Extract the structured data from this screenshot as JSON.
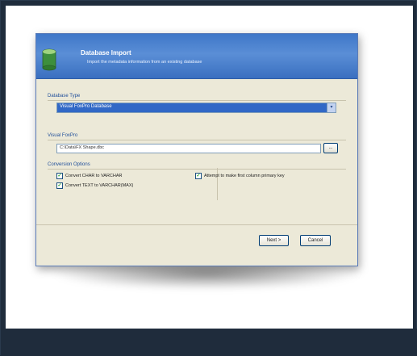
{
  "dialog": {
    "title": "Database Import",
    "subtitle": "Import the metadata information from an existing database"
  },
  "database_type": {
    "label": "Database Type",
    "selected": "Visual FoxPro Database"
  },
  "visual_foxpro": {
    "label": "Visual FoxPro",
    "path": "C:\\Data\\FX Shape.dbc",
    "browse_label": "..."
  },
  "conversion": {
    "label": "Conversion Options",
    "options": [
      {
        "label": "Convert CHAR to VARCHAR",
        "checked": true
      },
      {
        "label": "Convert TEXT to VARCHAR(MAX)",
        "checked": true
      },
      {
        "label": "Attempt to make first column primary key",
        "checked": true
      }
    ]
  },
  "buttons": {
    "next": "Next >",
    "cancel": "Cancel"
  },
  "colors": {
    "header_blue": "#3f77c8",
    "selection_blue": "#3168c6",
    "dialog_bg": "#ece9d8",
    "frame_dark": "#1f2c3c",
    "check_green": "#21a121"
  }
}
